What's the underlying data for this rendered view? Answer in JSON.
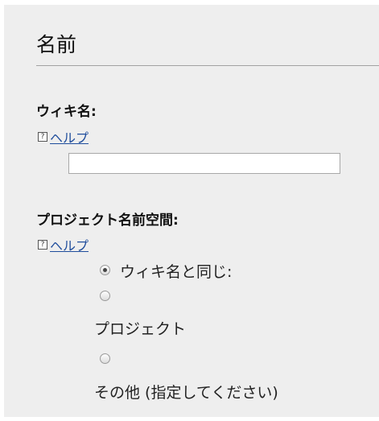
{
  "section": {
    "title": "名前"
  },
  "wiki_name": {
    "label": "ウィキ名:",
    "help_icon": "?",
    "help_label": "ヘルプ",
    "value": ""
  },
  "project_namespace": {
    "label": "プロジェクト名前空間:",
    "help_icon": "?",
    "help_label": "ヘルプ",
    "options": [
      {
        "label": "ウィキ名と同じ:",
        "selected": true
      },
      {
        "label": "プロジェクト",
        "selected": false
      },
      {
        "label": "その他 (指定してください)",
        "selected": false
      }
    ]
  }
}
